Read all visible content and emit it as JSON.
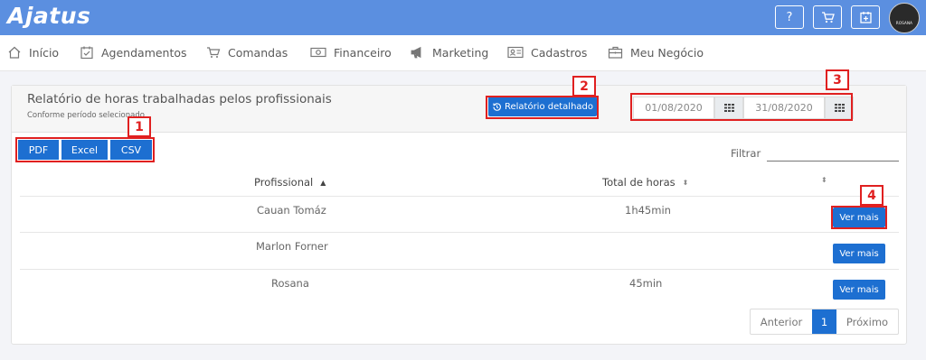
{
  "app": {
    "logo": "Ajatus",
    "avatar_text": "ROSANA"
  },
  "top_buttons": {
    "help": "?",
    "cart": "cart-icon",
    "calendar": "calendar-add-icon"
  },
  "nav": [
    {
      "label": "Início",
      "icon": "home-icon"
    },
    {
      "label": "Agendamentos",
      "icon": "calendar-check-icon"
    },
    {
      "label": "Comandas",
      "icon": "cart-icon"
    },
    {
      "label": "Financeiro",
      "icon": "money-icon"
    },
    {
      "label": "Marketing",
      "icon": "megaphone-icon"
    },
    {
      "label": "Cadastros",
      "icon": "id-card-icon"
    },
    {
      "label": "Meu Negócio",
      "icon": "briefcase-icon"
    }
  ],
  "report": {
    "title": "Relatório de horas trabalhadas pelos profissionais",
    "subtitle": "Conforme período selecionado",
    "detailed_button": "Relatório detalhado",
    "date_start": "01/08/2020",
    "date_end": "31/08/2020"
  },
  "export": {
    "pdf": "PDF",
    "excel": "Excel",
    "csv": "CSV"
  },
  "filter": {
    "label": "Filtrar",
    "value": ""
  },
  "table": {
    "headers": [
      "Profissional",
      "Total de horas",
      ""
    ],
    "rows": [
      {
        "name": "Cauan Tomáz",
        "hours": "1h45min",
        "action": "Ver mais"
      },
      {
        "name": "Marlon Forner",
        "hours": "",
        "action": "Ver mais"
      },
      {
        "name": "Rosana",
        "hours": "45min",
        "action": "Ver mais"
      }
    ]
  },
  "pagination": {
    "prev": "Anterior",
    "current": "1",
    "next": "Próximo"
  },
  "annotations": [
    "1",
    "2",
    "3",
    "4"
  ],
  "colors": {
    "header_bar": "#5b8fe0",
    "primary_button": "#1d6fd1",
    "annotation": "#e02020"
  }
}
